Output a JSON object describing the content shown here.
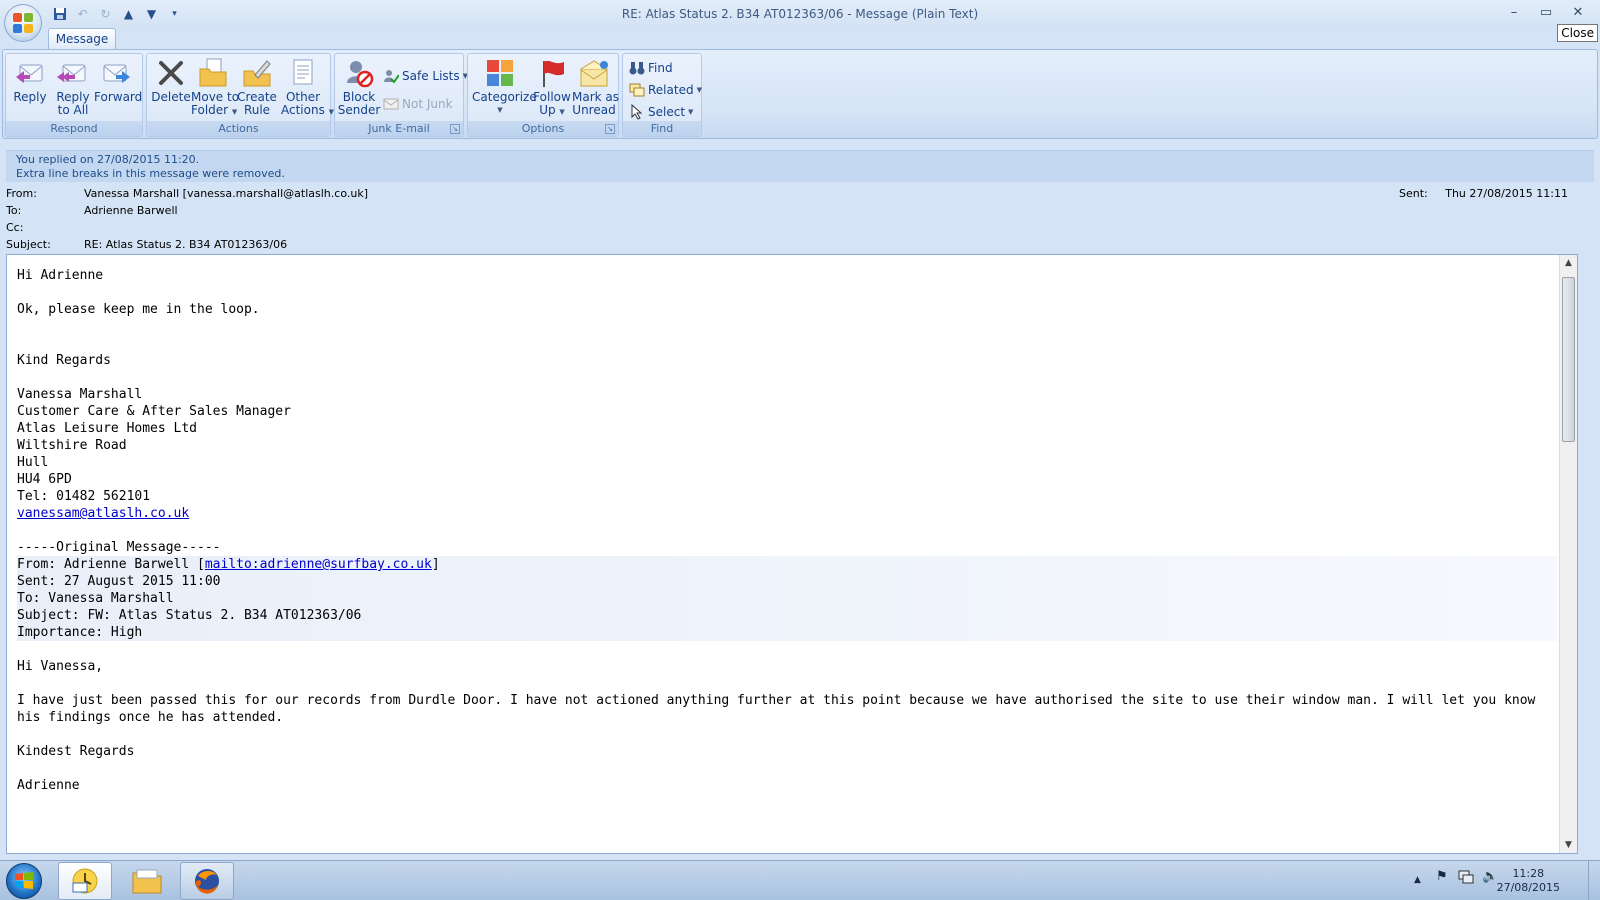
{
  "window": {
    "title": "RE: Atlas Status 2. B34    AT012363/06  - Message (Plain Text)",
    "close_tooltip": "Close"
  },
  "ribbon": {
    "tab": "Message",
    "groups": {
      "respond": "Respond",
      "actions": "Actions",
      "junk": "Junk E-mail",
      "options": "Options",
      "find": "Find"
    },
    "buttons": {
      "reply": "Reply",
      "reply_all_1": "Reply",
      "reply_all_2": "to All",
      "forward": "Forward",
      "delete": "Delete",
      "move_1": "Move to",
      "move_2": "Folder",
      "create_1": "Create",
      "create_2": "Rule",
      "other_1": "Other",
      "other_2": "Actions",
      "block_1": "Block",
      "block_2": "Sender",
      "safe_lists": "Safe Lists",
      "not_junk": "Not Junk",
      "categorize": "Categorize",
      "follow_1": "Follow",
      "follow_2": "Up",
      "mark_1": "Mark as",
      "mark_2": "Unread",
      "find": "Find",
      "related": "Related",
      "select": "Select"
    }
  },
  "info": {
    "line1": "You replied on 27/08/2015 11:20.",
    "line2": "Extra line breaks in this message were removed."
  },
  "header": {
    "from_label": "From:",
    "from_value": "Vanessa Marshall [vanessa.marshall@atlaslh.co.uk]",
    "to_label": "To:",
    "to_value": "Adrienne Barwell",
    "cc_label": "Cc:",
    "cc_value": "",
    "subject_label": "Subject:",
    "subject_value": "RE: Atlas Status 2. B34    AT012363/06",
    "sent_label": "Sent:",
    "sent_value": "Thu 27/08/2015 11:11"
  },
  "body": {
    "greeting": "Hi Adrienne",
    "line_loop": "Ok, please keep me in the loop.",
    "regards": "Kind Regards",
    "sig_name": "Vanessa Marshall",
    "sig_title": "Customer Care & After Sales Manager",
    "sig_company": "Atlas Leisure Homes Ltd",
    "sig_road": "Wiltshire Road",
    "sig_city": "Hull",
    "sig_postcode": "HU4 6PD",
    "sig_tel": "Tel: 01482 562101",
    "sig_email": "vanessam@atlaslh.co.uk",
    "orig_divider": "-----Original Message-----",
    "orig_from_prefix": "From: Adrienne Barwell [",
    "orig_from_link": "mailto:adrienne@surfbay.co.uk",
    "orig_from_suffix": "]",
    "orig_sent": "Sent: 27 August 2015 11:00",
    "orig_to": "To: Vanessa Marshall",
    "orig_subject": "Subject: FW: Atlas Status 2. B34 AT012363/06",
    "orig_importance": "Importance: High",
    "orig_greeting": "Hi Vanessa,",
    "orig_para": "I have just been passed this for our records from Durdle Door.  I have not actioned anything further at this point because we have authorised the site to use their window man.  I will let you know his findings once he has attended.",
    "orig_regards": "Kindest Regards",
    "orig_name": "Adrienne"
  },
  "taskbar": {
    "time": "11:28",
    "date": "27/08/2015"
  }
}
